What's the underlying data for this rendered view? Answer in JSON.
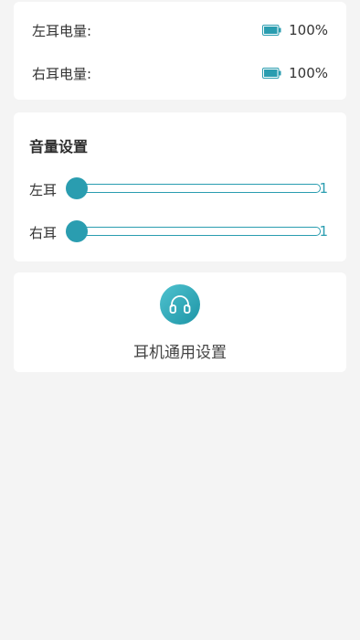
{
  "battery": {
    "left_label": "左耳电量:",
    "left_value": "100%",
    "right_label": "右耳电量:",
    "right_value": "100%",
    "icon": "battery-full-icon"
  },
  "volume": {
    "title": "音量设置",
    "left": {
      "label": "左耳",
      "value": "1",
      "level": 0
    },
    "right": {
      "label": "右耳",
      "value": "1",
      "level": 0
    }
  },
  "general": {
    "icon": "headphones-icon",
    "label": "耳机通用设置"
  },
  "colors": {
    "accent": "#2a9db0",
    "background": "#f4f4f4",
    "card": "#ffffff"
  }
}
